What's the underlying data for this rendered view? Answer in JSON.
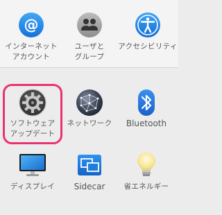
{
  "panes": {
    "internet_accounts": {
      "label": "インターネット\nアカウント"
    },
    "users_groups": {
      "label": "ユーザと\nグループ"
    },
    "accessibility": {
      "label": "アクセシビリティ"
    },
    "software_update": {
      "label": "ソフトウェア\nアップデート"
    },
    "network": {
      "label": "ネットワーク"
    },
    "bluetooth": {
      "label": "Bluetooth"
    },
    "displays": {
      "label": "ディスプレイ"
    },
    "sidecar": {
      "label": "Sidecar"
    },
    "energy_saver": {
      "label": "省エネルギー"
    }
  },
  "highlight": {
    "target": "software_update",
    "color": "#e8336d"
  }
}
